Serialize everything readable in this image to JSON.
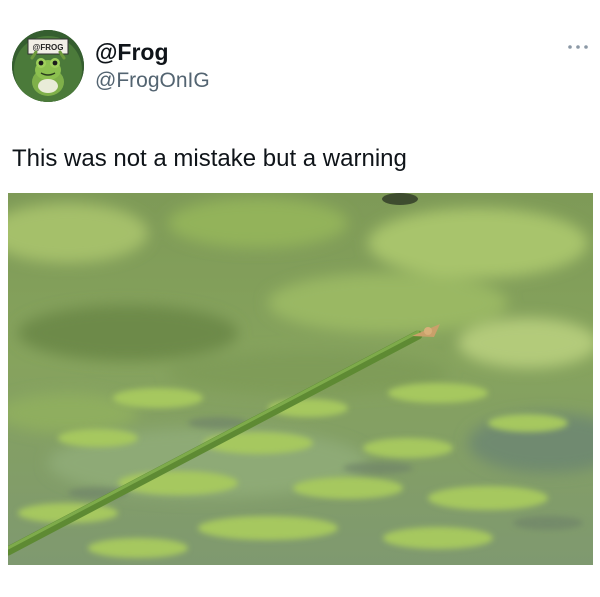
{
  "tweet": {
    "author": {
      "display_name": "@Frog",
      "handle": "@FrogOnIG",
      "avatar_sign_text": "@FROG",
      "avatar_icon": "frog-holding-sign-avatar"
    },
    "more_icon": "ellipsis-icon",
    "text": "This was not a mistake but a warning",
    "media": {
      "kind": "video-still",
      "scene": "green reed stem over pond with lily pads",
      "colors": {
        "water": "#7f9a6a",
        "lily_pads": "#9cc05a",
        "reed": "#6f9a3c",
        "reed_tip": "#c9a06a"
      }
    }
  }
}
